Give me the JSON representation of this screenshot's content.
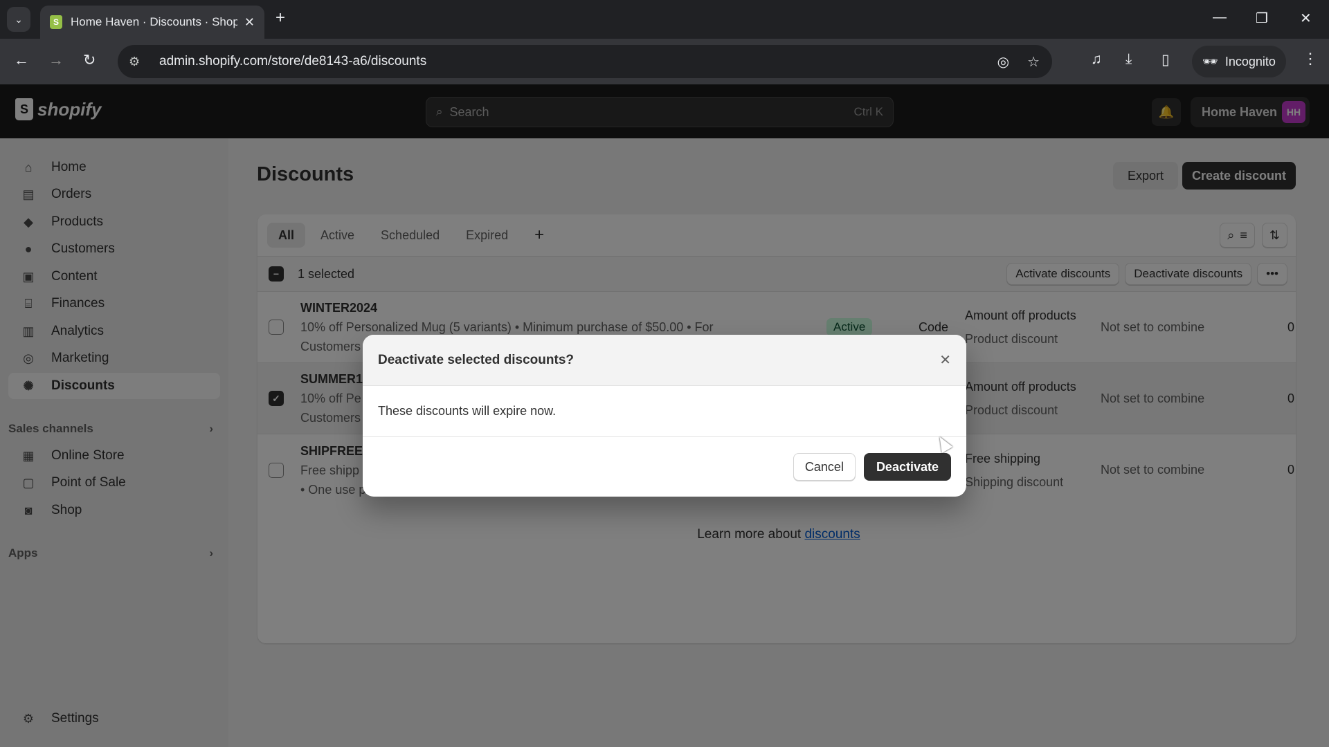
{
  "browser": {
    "tab_title": "Home Haven · Discounts · Shopify",
    "url": "admin.shopify.com/store/de8143-a6/discounts",
    "incognito_label": "Incognito"
  },
  "topbar": {
    "logo_text": "shopify",
    "search_placeholder": "Search",
    "search_shortcut": "Ctrl K",
    "store_name": "Home Haven",
    "avatar_initials": "HH"
  },
  "sidebar": {
    "items": [
      {
        "label": "Home",
        "icon": "home-icon"
      },
      {
        "label": "Orders",
        "icon": "inbox-icon"
      },
      {
        "label": "Products",
        "icon": "tag-icon"
      },
      {
        "label": "Customers",
        "icon": "person-icon"
      },
      {
        "label": "Content",
        "icon": "image-icon"
      },
      {
        "label": "Finances",
        "icon": "bank-icon"
      },
      {
        "label": "Analytics",
        "icon": "bar-chart-icon"
      },
      {
        "label": "Marketing",
        "icon": "target-icon"
      },
      {
        "label": "Discounts",
        "icon": "discount-icon",
        "active": true
      }
    ],
    "sales_channels_label": "Sales channels",
    "channels": [
      {
        "label": "Online Store",
        "icon": "store-icon"
      },
      {
        "label": "Point of Sale",
        "icon": "pos-icon"
      },
      {
        "label": "Shop",
        "icon": "shop-icon"
      }
    ],
    "apps_label": "Apps",
    "settings_label": "Settings"
  },
  "page": {
    "title": "Discounts",
    "export_label": "Export",
    "create_label": "Create discount",
    "tabs": [
      "All",
      "Active",
      "Scheduled",
      "Expired"
    ],
    "active_tab": "All",
    "bulk": {
      "selected_label": "1 selected",
      "activate_label": "Activate discounts",
      "deactivate_label": "Deactivate discounts"
    },
    "rows": [
      {
        "code": "WINTER2024",
        "desc1": "10% off Personalized Mug (5 variants) • Minimum purchase of $50.00 • For",
        "desc2": "Customers",
        "status": "Active",
        "method": "Code",
        "type": "Amount off products",
        "type_sub": "Product discount",
        "combine": "Not set to combine",
        "used": "0",
        "selected": false
      },
      {
        "code": "SUMMER1",
        "desc1": "10% off Pe",
        "desc2": "Customers",
        "status": "",
        "method": "",
        "type": "Amount off products",
        "type_sub": "Product discount",
        "combine": "Not set to combine",
        "used": "0",
        "selected": true
      },
      {
        "code": "SHIPFREE",
        "desc1": "Free shipp",
        "desc2": "• One use p",
        "status": "",
        "method": "",
        "type": "Free shipping",
        "type_sub": "Shipping discount",
        "combine": "Not set to combine",
        "used": "0",
        "selected": false
      }
    ],
    "learn_prefix": "Learn more about ",
    "learn_link": "discounts"
  },
  "modal": {
    "title": "Deactivate selected discounts?",
    "body": "These discounts will expire now.",
    "cancel_label": "Cancel",
    "confirm_label": "Deactivate"
  }
}
